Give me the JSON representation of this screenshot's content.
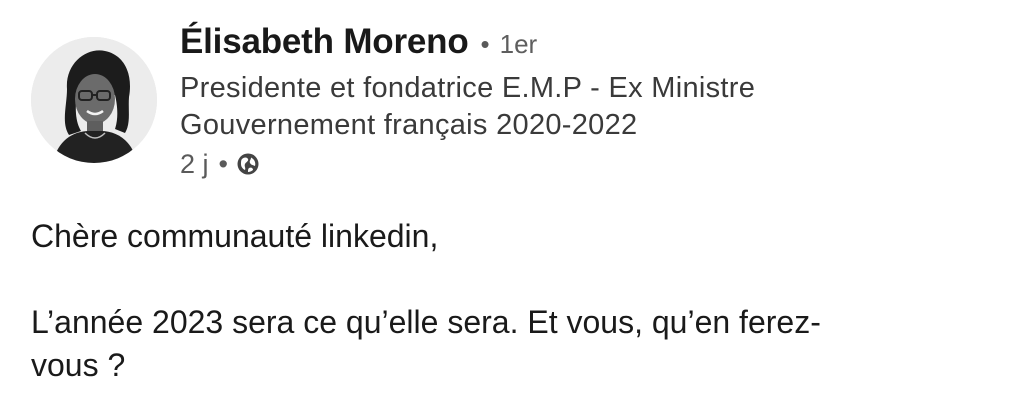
{
  "post": {
    "author": {
      "name": "Élisabeth Moreno",
      "separator": "•",
      "connection_degree": "1er",
      "headline_line1": "Presidente et fondatrice E.M.P - Ex Ministre",
      "headline_line2": "Gouvernement français 2020-2022",
      "avatar_icon": "profile-photo"
    },
    "meta": {
      "time_ago": "2 j",
      "separator": "•",
      "visibility_icon": "globe-icon"
    },
    "content": {
      "line1": "Chère communauté linkedin,",
      "line2": "L’année 2023 sera ce qu’elle sera. Et vous, qu’en ferez-",
      "line3": "vous ?"
    }
  }
}
